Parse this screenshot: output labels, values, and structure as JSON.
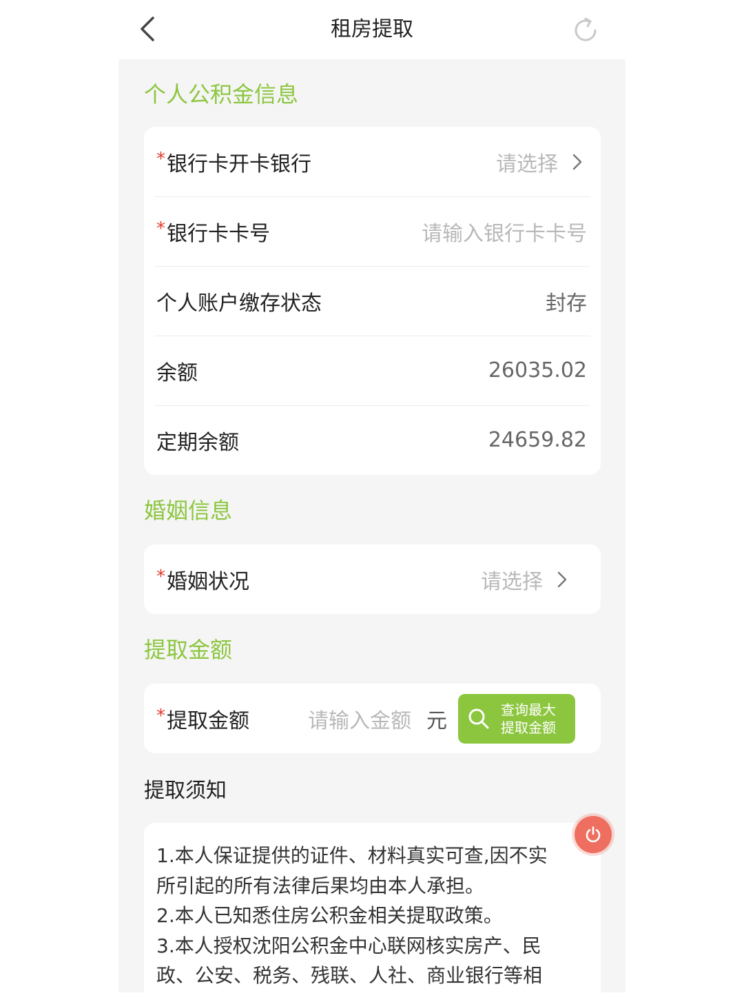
{
  "header": {
    "title": "租房提取",
    "back_icon": "chevron-left-icon",
    "refresh_icon": "refresh-icon"
  },
  "sections": {
    "personal_info": "个人公积金信息",
    "marriage_info": "婚姻信息",
    "withdraw_amount": "提取金额",
    "notice": "提取须知"
  },
  "personal": {
    "bank": {
      "label": "银行卡开卡银行",
      "placeholder": "请选择"
    },
    "card_no": {
      "label": "银行卡卡号",
      "placeholder": "请输入银行卡卡号"
    },
    "status": {
      "label": "个人账户缴存状态",
      "value": "封存"
    },
    "balance": {
      "label": "余额",
      "value": "26035.02"
    },
    "fixed_balance": {
      "label": "定期余额",
      "value": "24659.82"
    }
  },
  "marriage": {
    "status": {
      "label": "婚姻状况",
      "placeholder": "请选择"
    }
  },
  "amount": {
    "label": "提取金额",
    "placeholder": "请输入金额",
    "unit": "元",
    "query_line1": "查询最大",
    "query_line2": "提取金额"
  },
  "required_mark": "*",
  "notice_lines": [
    "1.本人保证提供的证件、材料真实可查,因不实",
    "所引起的所有法律后果均由本人承担。",
    "2.本人已知悉住房公积金相关提取政策。",
    "3.本人授权沈阳公积金中心联网核实房产、民",
    "政、公安、税务、残联、人社、商业银行等相"
  ],
  "colors": {
    "accent": "#8cc63f",
    "required": "#e03c2d",
    "power": "#ee6f60",
    "background": "#f5f5f5"
  }
}
